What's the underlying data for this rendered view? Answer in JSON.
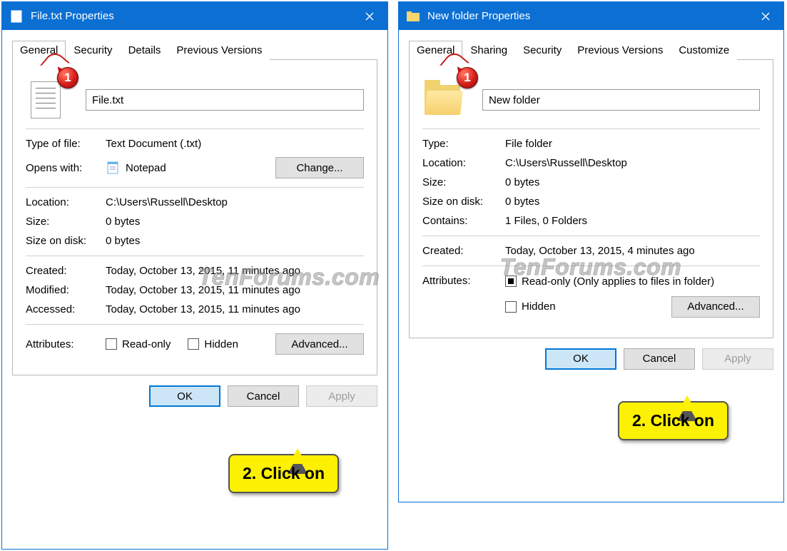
{
  "watermark": "TenForums.com",
  "left": {
    "title": "File.txt Properties",
    "tabs": [
      "General",
      "Security",
      "Details",
      "Previous Versions"
    ],
    "active_tab": 0,
    "filename": "File.txt",
    "rows": {
      "type_of_file_label": "Type of file:",
      "type_of_file": "Text Document (.txt)",
      "opens_with_label": "Opens with:",
      "opens_with": "Notepad",
      "change": "Change...",
      "location_label": "Location:",
      "location": "C:\\Users\\Russell\\Desktop",
      "size_label": "Size:",
      "size": "0 bytes",
      "size_on_disk_label": "Size on disk:",
      "size_on_disk": "0 bytes",
      "created_label": "Created:",
      "created": "Today, October 13, 2015, 11 minutes ago",
      "modified_label": "Modified:",
      "modified": "Today, October 13, 2015, 11 minutes ago",
      "accessed_label": "Accessed:",
      "accessed": "Today, October 13, 2015, 11 minutes ago",
      "attributes_label": "Attributes:",
      "readonly": "Read-only",
      "hidden": "Hidden",
      "advanced": "Advanced..."
    },
    "buttons": {
      "ok": "OK",
      "cancel": "Cancel",
      "apply": "Apply"
    },
    "annotations": {
      "marker": "1",
      "callout": "2. Click on"
    }
  },
  "right": {
    "title": "New folder Properties",
    "tabs": [
      "General",
      "Sharing",
      "Security",
      "Previous Versions",
      "Customize"
    ],
    "active_tab": 0,
    "filename": "New folder",
    "rows": {
      "type_label": "Type:",
      "type": "File folder",
      "location_label": "Location:",
      "location": "C:\\Users\\Russell\\Desktop",
      "size_label": "Size:",
      "size": "0 bytes",
      "size_on_disk_label": "Size on disk:",
      "size_on_disk": "0 bytes",
      "contains_label": "Contains:",
      "contains": "1 Files, 0 Folders",
      "created_label": "Created:",
      "created": "Today, October 13, 2015, 4 minutes ago",
      "attributes_label": "Attributes:",
      "readonly": "Read-only (Only applies to files in folder)",
      "hidden": "Hidden",
      "advanced": "Advanced..."
    },
    "buttons": {
      "ok": "OK",
      "cancel": "Cancel",
      "apply": "Apply"
    },
    "annotations": {
      "marker": "1",
      "callout": "2. Click on"
    }
  }
}
